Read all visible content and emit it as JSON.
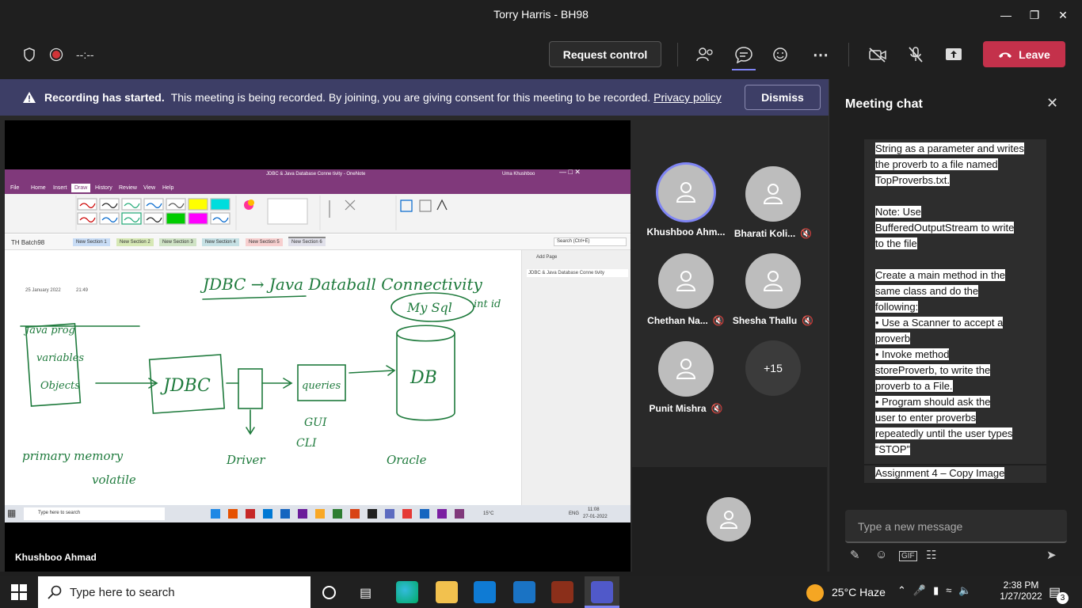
{
  "window": {
    "title": "Torry Harris - BH98"
  },
  "toolbar": {
    "timer": "--:--",
    "request_control": "Request control",
    "leave": "Leave"
  },
  "banner": {
    "heading": "Recording has started.",
    "message": "This meeting is being recorded. By joining, you are giving consent for this meeting to be recorded.",
    "link": "Privacy policy",
    "dismiss": "Dismiss"
  },
  "presenter": {
    "name": "Khushboo Ahmad"
  },
  "onenote": {
    "window_title": "JDBC & Java Database Conne tivity  -  OneNote",
    "user": "Uma Khushboo",
    "menu": [
      "File",
      "Home",
      "Insert",
      "Draw",
      "History",
      "Review",
      "View",
      "Help"
    ],
    "active_menu": "Draw",
    "notebook": "TH Batch98",
    "sections": [
      "New Section 1",
      "New Section 2",
      "New Section 3",
      "New Section 4",
      "New Section 5",
      "New Section 6"
    ],
    "search_placeholder": "Search (Ctrl+E)",
    "add_page": "Add Page",
    "page_entry": "JDBC & Java Database Conne tivity",
    "page_date": "25 January 2022",
    "page_time": "21:49",
    "inner_taskbar_search": "Type here to search",
    "inner_clock_time": "11:08",
    "inner_clock_date": "27-01-2022",
    "inner_temp": "15°C",
    "inner_lang": "ENG",
    "handwriting": [
      "JDBC → Java Databall Connectivity",
      "Java prog",
      "variables",
      "Objects",
      "JDBC",
      "queries",
      "GUI",
      "CLI",
      "My Sql",
      "DB",
      "Oracle",
      "primary memory",
      "volatile",
      "Driver",
      "int id"
    ]
  },
  "participants": [
    {
      "name": "Khushboo Ahm...",
      "muted": false,
      "speaking": true
    },
    {
      "name": "Bharati Koli...",
      "muted": true,
      "speaking": false
    },
    {
      "name": "Chethan Na...",
      "muted": true,
      "speaking": false
    },
    {
      "name": "Shesha Thallu",
      "muted": true,
      "speaking": false
    },
    {
      "name": "Punit Mishra",
      "muted": true,
      "speaking": false
    }
  ],
  "overflow_count": "+15",
  "chat": {
    "title": "Meeting chat",
    "lines": [
      "String as a parameter and writes",
      "the proverb to a file named",
      "TopProverbs.txt.",
      "",
      "Note: Use",
      "BufferedOutputStream to write",
      "to the file",
      "",
      "Create a main method in the",
      "same class and do the",
      "following:",
      "•       Use a Scanner to accept a",
      "proverb",
      "•       Invoke method",
      "storeProverb, to write the",
      "proverb to a File.",
      "•       Program should ask the",
      "user to enter proverbs",
      "repeatedly until the user types",
      "“STOP”"
    ],
    "next_message": "Assignment 4 – Copy Image",
    "compose_placeholder": "Type a new message"
  },
  "taskbar": {
    "search": "Type here to search",
    "weather": "25°C  Haze",
    "time": "2:38 PM",
    "date": "1/27/2022",
    "notifications": "3"
  },
  "colors": {
    "leave": "#c4314b",
    "banner": "#3d3e66",
    "onenote": "#80397b",
    "ink": "#1e7a3c"
  }
}
